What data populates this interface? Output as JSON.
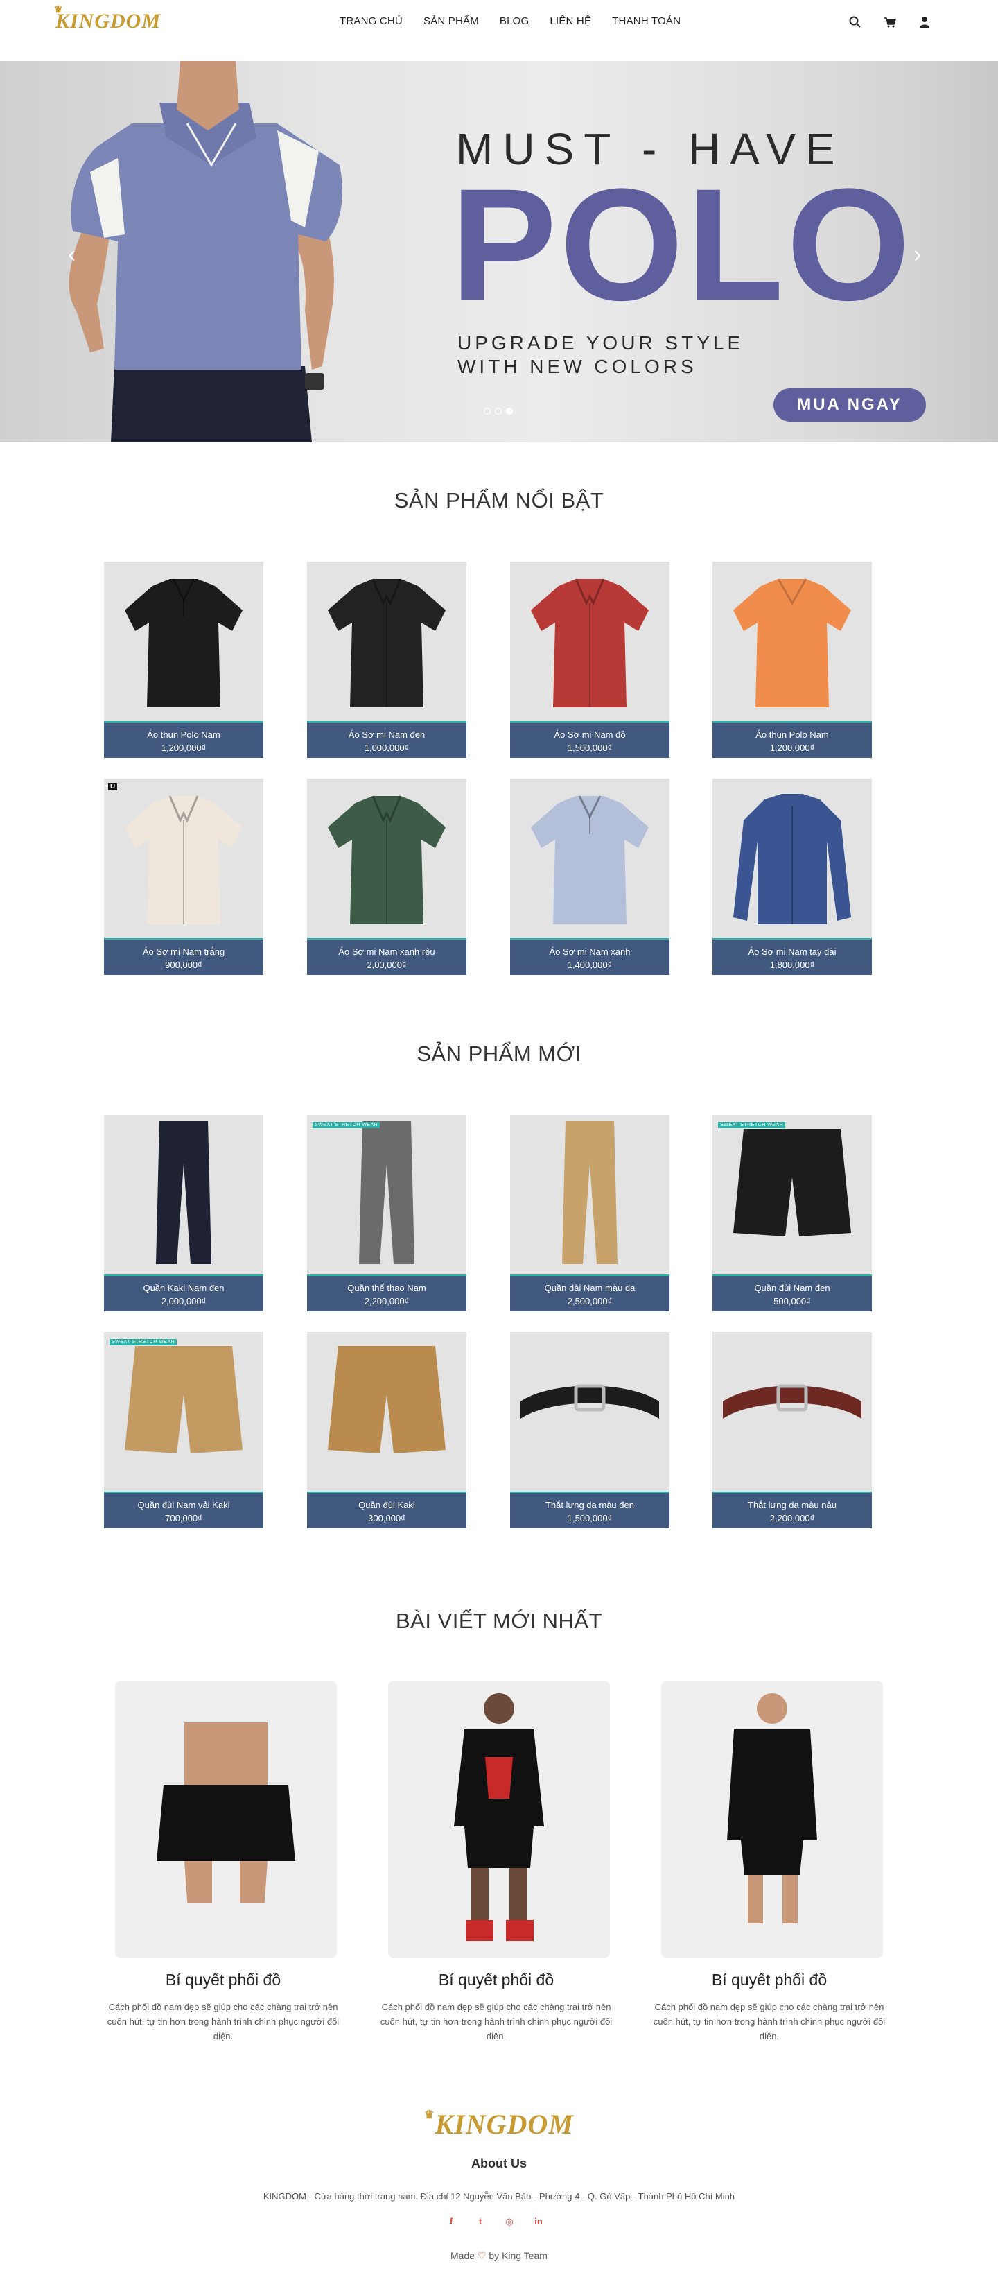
{
  "brand": {
    "name": "KINGDOM",
    "crown": "♛"
  },
  "nav": {
    "items": [
      "TRANG CHỦ",
      "SẢN PHẨM",
      "BLOG",
      "LIÊN HỆ",
      "THANH TOÁN"
    ],
    "icons": [
      "search-icon",
      "cart-icon",
      "user-icon"
    ]
  },
  "hero": {
    "line1": "MUST - HAVE",
    "line2": "POLO",
    "sub1": "UPGRADE YOUR STYLE",
    "sub2": "WITH NEW COLORS",
    "cta": "MUA NGAY",
    "prev": "‹",
    "next": "›",
    "slides": 3,
    "active_slide": 3,
    "accent": "#5f5f9e"
  },
  "featured": {
    "title": "SẢN PHẨM NỔI BẬT",
    "products": [
      {
        "name": "Áo thun Polo Nam",
        "price": "1,200,000₫",
        "color": "#1c1c1c",
        "kind": "polo"
      },
      {
        "name": "Áo Sơ mi Nam đen",
        "price": "1,000,000₫",
        "color": "#222222",
        "kind": "shirt"
      },
      {
        "name": "Áo Sơ mi Nam đỏ",
        "price": "1,500,000₫",
        "color": "#b83a36",
        "kind": "shirt"
      },
      {
        "name": "Áo thun Polo Nam",
        "price": "1,200,000₫",
        "color": "#f08c4c",
        "kind": "tee"
      },
      {
        "name": "Áo Sơ mi Nam trắng",
        "price": "900,000₫",
        "color": "#efe6dc",
        "kind": "shirt",
        "tag": "U"
      },
      {
        "name": "Áo Sơ mi Nam xanh rêu",
        "price": "2,00,000₫",
        "color": "#3d5c48",
        "kind": "shirt"
      },
      {
        "name": "Áo Sơ mi Nam xanh",
        "price": "1,400,000₫",
        "color": "#b4bfda",
        "kind": "polo"
      },
      {
        "name": "Áo Sơ mi Nam tay dài",
        "price": "1,800,000₫",
        "color": "#3a5592",
        "kind": "longshirt"
      }
    ]
  },
  "new": {
    "title": "SẢN PHẨM MỚI",
    "products": [
      {
        "name": "Quần Kaki Nam đen",
        "price": "2,000,000₫",
        "color": "#1e2233",
        "kind": "pants"
      },
      {
        "name": "Quần thể thao Nam",
        "price": "2,200,000₫",
        "color": "#6b6b6b",
        "kind": "pants",
        "badge": "SWEAT STRETCH WEAR"
      },
      {
        "name": "Quần dài Nam màu da",
        "price": "2,500,000₫",
        "color": "#c7a26a",
        "kind": "pants"
      },
      {
        "name": "Quần đùi Nam đen",
        "price": "500,000₫",
        "color": "#1c1c1c",
        "kind": "shorts",
        "badge": "SWEAT STRETCH WEAR"
      },
      {
        "name": "Quần đùi Nam vải Kaki",
        "price": "700,000₫",
        "color": "#c49a63",
        "kind": "shorts",
        "badge": "SWEAT STRETCH WEAR"
      },
      {
        "name": "Quần đùi Kaki",
        "price": "300,000₫",
        "color": "#b98b4f",
        "kind": "shorts"
      },
      {
        "name": "Thắt lưng da màu đen",
        "price": "1,500,000₫",
        "color": "#1c1c1c",
        "kind": "belt"
      },
      {
        "name": "Thắt lưng da màu nâu",
        "price": "2,200,000₫",
        "color": "#6e2a22",
        "kind": "belt"
      }
    ]
  },
  "blog": {
    "title": "BÀI VIẾT MỚI NHẤT",
    "posts": [
      {
        "title": "Bí quyết phối đồ",
        "desc": "Cách phối đồ nam đẹp sẽ giúp cho các chàng trai trở nên cuốn hút, tự tin hơn trong hành trình chinh phục người đối diện."
      },
      {
        "title": "Bí quyết phối đồ",
        "desc": "Cách phối đồ nam đẹp sẽ giúp cho các chàng trai trở nên cuốn hút, tự tin hơn trong hành trình chinh phục người đối diện."
      },
      {
        "title": "Bí quyết phối đồ",
        "desc": "Cách phối đồ nam đẹp sẽ giúp cho các chàng trai trở nên cuốn hút, tự tin hơn trong hành trình chinh phục người đối diện."
      }
    ]
  },
  "footer": {
    "about": "About Us",
    "address": "KINGDOM - Cửa hàng thời trang nam. Địa chỉ 12 Nguyễn Văn Bảo - Phường 4 - Q. Gò Vấp - Thành Phố Hồ Chí Minh",
    "social": [
      "f",
      "t",
      "◎",
      "in"
    ],
    "social_icons": [
      "facebook-icon",
      "twitter-icon",
      "instagram-icon",
      "linkedin-icon"
    ],
    "made_prefix": "Made",
    "heart": "♡",
    "made_suffix": "by King Team"
  }
}
